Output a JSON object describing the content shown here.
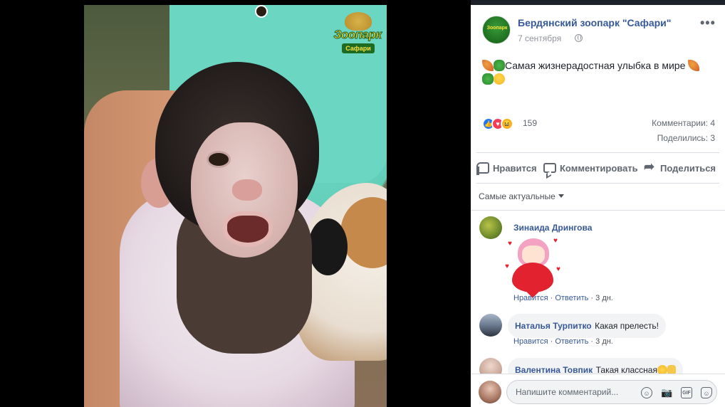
{
  "post": {
    "page_name": "Бердянский зоопарк \"Сафари\"",
    "time": "7 сентября",
    "text_main": "Самая жизнерадостная улыбка в мире",
    "reactions_count": "159",
    "comments_count": "Комментарии: 4",
    "shares_count": "Поделились: 3"
  },
  "logo": {
    "line1": "Зоопарк",
    "line2": "Сафари"
  },
  "actions": {
    "like": "Нравится",
    "comment": "Комментировать",
    "share": "Поделиться"
  },
  "sort_label": "Самые актуальные",
  "comments": [
    {
      "name": "Зинаида Дрингова",
      "text": "",
      "like": "Нравится",
      "reply": "Ответить",
      "age": "3 дн."
    },
    {
      "name": "Наталья Турпитко",
      "text": "Какая прелесть!",
      "like": "Нравится",
      "reply": "Ответить",
      "age": "3 дн."
    },
    {
      "name": "Валентина Товпик",
      "text": "Такая классная"
    }
  ],
  "composer": {
    "placeholder": "Напишите комментарий..."
  },
  "icons": [
    "globe-icon",
    "more-icon",
    "like-icon",
    "comment-icon",
    "share-icon",
    "emoji-icon",
    "camera-icon",
    "gif-icon",
    "sticker-icon"
  ]
}
